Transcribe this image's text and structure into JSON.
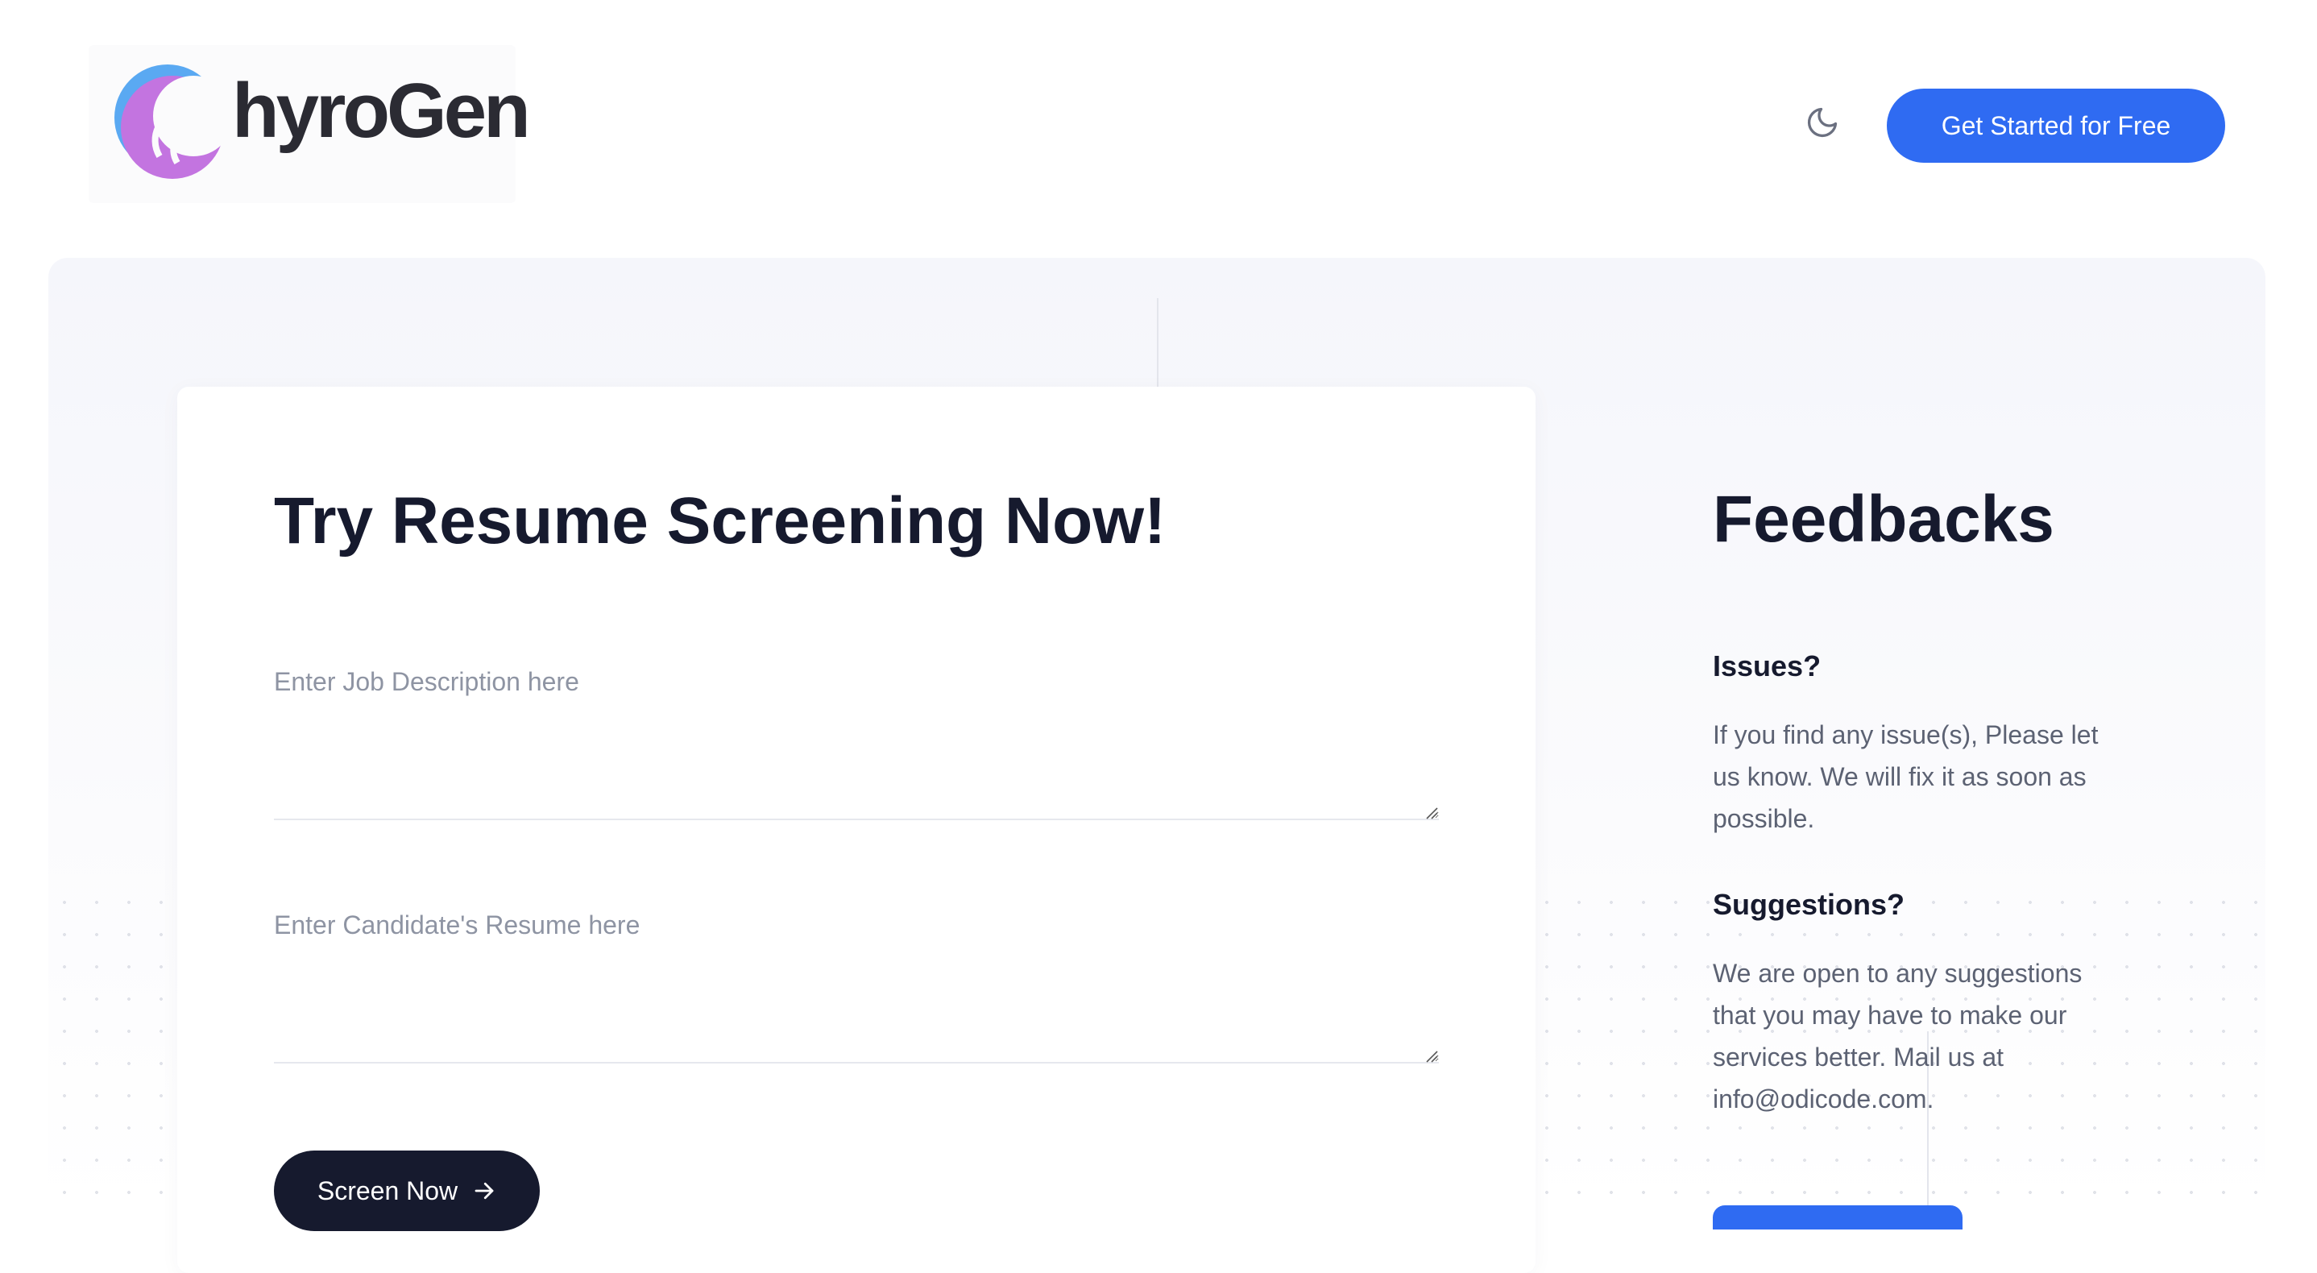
{
  "header": {
    "logo_text": "hyroGen",
    "theme_toggle_icon": "moon-icon",
    "cta_label": "Get Started for Free"
  },
  "form": {
    "title": "Try Resume Screening Now!",
    "job_description": {
      "placeholder": "Enter Job Description here",
      "value": ""
    },
    "resume": {
      "placeholder": "Enter Candidate's Resume here",
      "value": ""
    },
    "submit_label": "Screen Now",
    "submit_icon": "arrow-right-icon"
  },
  "feedback": {
    "title": "Feedbacks",
    "issues_heading": "Issues?",
    "issues_text": "If you find any issue(s), Please let us know. We will fix it as soon as possible.",
    "suggestions_heading": "Suggestions?",
    "suggestions_text": "We are open to any suggestions that you may have to make our services better. Mail us at info@odicode.com."
  },
  "colors": {
    "accent": "#2f6bf2",
    "dark": "#161a2e",
    "muted_text": "#5c6273",
    "logo_purple": "#c374e0",
    "logo_blue": "#5aa9f2"
  }
}
